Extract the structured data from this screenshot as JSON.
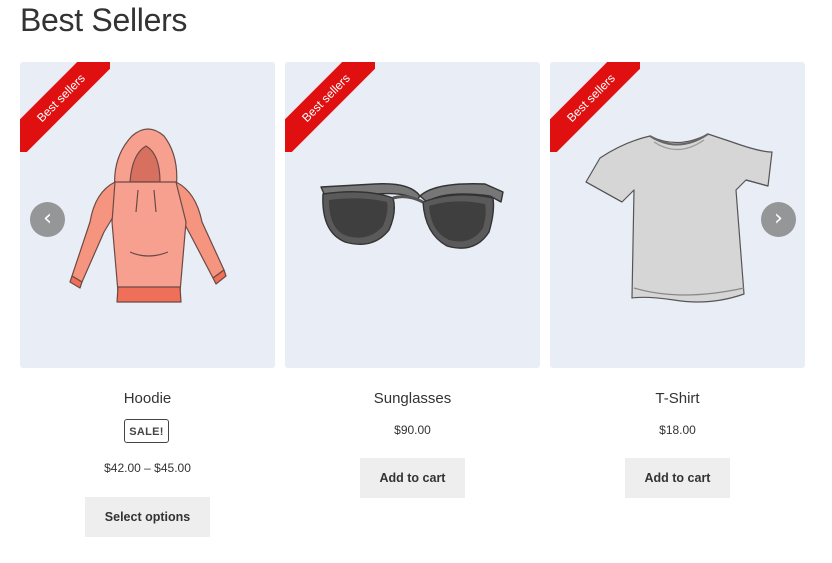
{
  "section": {
    "title": "Best Sellers"
  },
  "ribbon_text": "Best sellers",
  "products": [
    {
      "name": "Hoodie",
      "badge": "SALE!",
      "price": "$42.00 – $45.00",
      "button": "Select options",
      "image_icon": "hoodie-icon"
    },
    {
      "name": "Sunglasses",
      "price": "$90.00",
      "button": "Add to cart",
      "image_icon": "sunglasses-icon"
    },
    {
      "name": "T-Shirt",
      "price": "$18.00",
      "button": "Add to cart",
      "image_icon": "tshirt-icon"
    }
  ],
  "nav": {
    "prev_icon": "chevron-left-icon",
    "next_icon": "chevron-right-icon"
  },
  "colors": {
    "ribbon": "#e01010",
    "card_bg": "#e9edf5",
    "button_bg": "#eeeeee",
    "text": "#333333",
    "arrow_bg": "#7a7a7a"
  }
}
